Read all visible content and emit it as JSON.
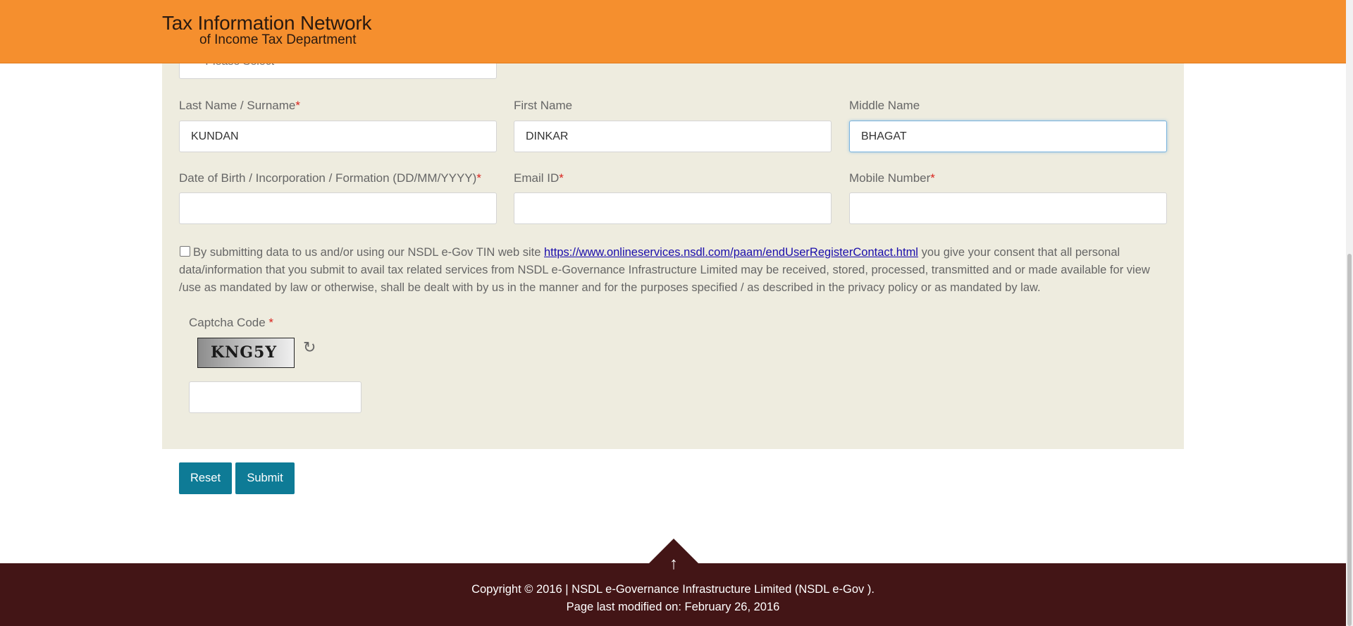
{
  "header": {
    "logo_line1": "Tax Information Network",
    "logo_line2": "of Income Tax Department"
  },
  "form": {
    "select_value": "----Please Select------",
    "last_name": {
      "label": "Last Name / Surname",
      "required": "*",
      "value": "KUNDAN"
    },
    "first_name": {
      "label": "First Name",
      "value": "DINKAR"
    },
    "middle_name": {
      "label": "Middle Name",
      "value": "BHAGAT"
    },
    "dob": {
      "label": "Date of Birth / Incorporation / Formation (DD/MM/YYYY)",
      "required": "*",
      "value": ""
    },
    "email": {
      "label": "Email ID",
      "required": "*",
      "value": ""
    },
    "mobile": {
      "label": "Mobile Number",
      "required": "*",
      "value": ""
    },
    "consent": {
      "text_before": "By submitting data to us and/or using our NSDL e-Gov TIN web site ",
      "link": "https://www.onlineservices.nsdl.com/paam/endUserRegisterContact.html",
      "text_after": " you give your consent that all personal data/information that you submit to avail tax related services from NSDL e-Governance Infrastructure Limited may be received, stored, processed, transmitted and or made available for view /use as mandated by law or otherwise, shall be dealt with by us in the manner and for the purposes specified / as described in the privacy policy or as mandated by law."
    },
    "captcha": {
      "label": "Captcha Code",
      "required": "*",
      "code": "KNG5Y",
      "value": ""
    },
    "reset_label": "Reset",
    "submit_label": "Submit"
  },
  "footer": {
    "copyright": "Copyright © 2016 | NSDL e-Governance Infrastructure Limited (NSDL e-Gov ).",
    "last_modified": "Page last modified on: February 26, 2016"
  },
  "colors": {
    "header_bg": "#f58f2e",
    "panel_bg": "#eeecdf",
    "button_bg": "#0e7b96",
    "footer_bg": "#431516",
    "required": "#d9231d"
  },
  "icons": [
    "chevron-down-icon",
    "refresh-icon",
    "arrow-up-icon"
  ]
}
